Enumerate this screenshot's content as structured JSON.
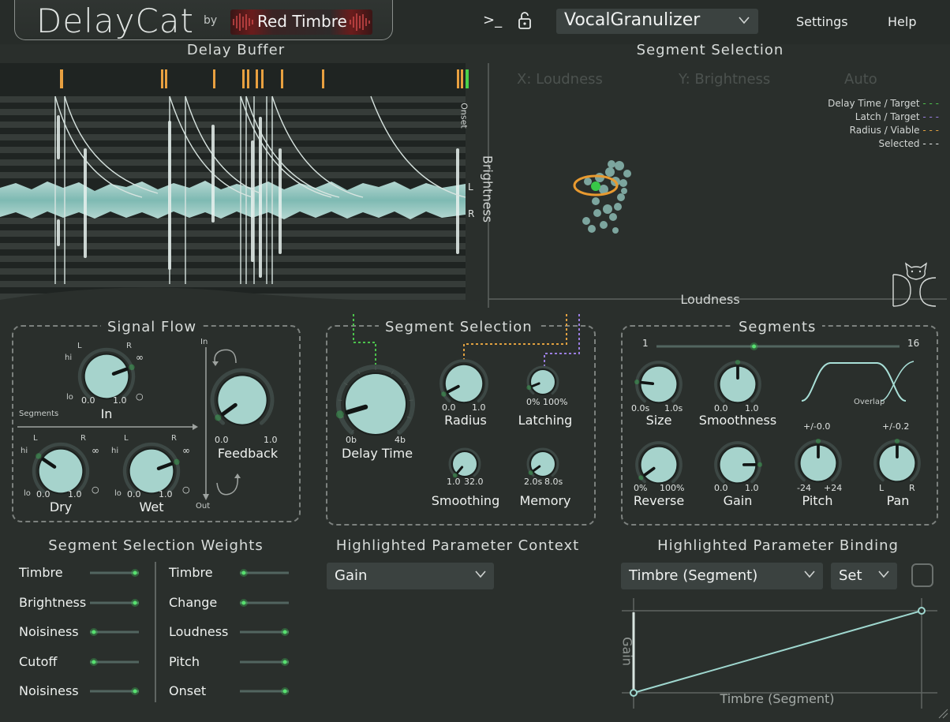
{
  "app": {
    "title": "DelayCat",
    "by": "by",
    "brand": "Red Timbre"
  },
  "toolbar": {
    "terminal_icon_text": ">_",
    "preset": "VocalGranulizer",
    "settings_label": "Settings",
    "help_label": "Help"
  },
  "delay_buffer": {
    "title": "Delay Buffer",
    "onset_label": "Onset",
    "left_label": "L",
    "right_label": "R"
  },
  "segment_plot": {
    "title": "Segment Selection",
    "x_axis_select": "X: Loudness",
    "y_axis_select": "Y: Brightness",
    "mode_select": "Auto",
    "xlabel": "Loudness",
    "ylabel": "Brightness",
    "legend": [
      {
        "label": "Delay Time / Target",
        "color": "#4cc24c"
      },
      {
        "label": "Latch / Target",
        "color": "#9a7ee0"
      },
      {
        "label": "Radius / Viable",
        "color": "#e0a040"
      },
      {
        "label": "Selected",
        "color": "#e8ecea"
      }
    ]
  },
  "signal_flow": {
    "title": "Signal Flow",
    "segments_label": "Segments",
    "in_label": "In",
    "out_label": "Out",
    "knobs": {
      "in": {
        "label": "In",
        "min": "0.0",
        "max": "1.0",
        "value": 0.75
      },
      "dry": {
        "label": "Dry",
        "min": "0.0",
        "max": "1.0",
        "value": 0.3
      },
      "wet": {
        "label": "Wet",
        "min": "0.0",
        "max": "1.0",
        "value": 0.75
      },
      "feedback": {
        "label": "Feedback",
        "min": "0.0",
        "max": "1.0",
        "value": 0.05
      }
    },
    "eq_labels": {
      "hi": "hi",
      "lo": "lo",
      "l": "L",
      "r": "R"
    }
  },
  "segment_selection": {
    "title": "Segment Selection",
    "knobs": {
      "delay_time": {
        "label": "Delay Time",
        "min": "0b",
        "max": "4b",
        "value": 0.12
      },
      "radius": {
        "label": "Radius",
        "min": "0.0",
        "max": "1.0",
        "value": 0.08
      },
      "latching": {
        "label": "Latching",
        "min": "0%",
        "max": "100%",
        "value": 0.1
      },
      "smoothing": {
        "label": "Smoothing",
        "min": "1.0",
        "max": "32.0",
        "value": 0.0
      },
      "memory": {
        "label": "Memory",
        "min": "2.0s",
        "max": "8.0s",
        "value": 0.05
      }
    }
  },
  "segments": {
    "title": "Segments",
    "range_min": "1",
    "range_max": "16",
    "range_value": 0.4,
    "overlap_label": "Overlap",
    "knobs": {
      "size": {
        "label": "Size",
        "min": "0.0s",
        "max": "1.0s",
        "value": 0.2
      },
      "smoothness": {
        "label": "Smoothness",
        "min": "0.0",
        "max": "1.0",
        "value": 0.5
      },
      "reverse": {
        "label": "Reverse",
        "min": "0%",
        "max": "100%",
        "value": 0.05
      },
      "gain": {
        "label": "Gain",
        "min": "0.0",
        "max": "1.0",
        "value": 0.82
      },
      "pitch": {
        "label": "Pitch",
        "min": "-24",
        "max": "+24",
        "value": 0.5,
        "readout": "+/-0.0"
      },
      "pan": {
        "label": "Pan",
        "min": "L",
        "max": "R",
        "value": 0.5,
        "readout": "+/-0.2"
      }
    }
  },
  "weights": {
    "title": "Segment Selection Weights",
    "left": [
      {
        "label": "Timbre",
        "value": 0.95
      },
      {
        "label": "Brightness",
        "value": 0.95
      },
      {
        "label": "Noisiness",
        "value": 0.05
      },
      {
        "label": "Cutoff",
        "value": 0.05
      },
      {
        "label": "Noisiness",
        "value": 0.95
      }
    ],
    "right": [
      {
        "label": "Timbre",
        "value": 0.05
      },
      {
        "label": "Change",
        "value": 0.05
      },
      {
        "label": "Loudness",
        "value": 0.95
      },
      {
        "label": "Pitch",
        "value": 0.95
      },
      {
        "label": "Onset",
        "value": 0.95
      }
    ]
  },
  "context": {
    "title": "Highlighted Parameter Context",
    "value": "Gain"
  },
  "binding": {
    "title": "Highlighted Parameter Binding",
    "source": "Timbre (Segment)",
    "mode": "Set",
    "xlabel": "Timbre (Segment)",
    "ylabel": "Gain"
  }
}
